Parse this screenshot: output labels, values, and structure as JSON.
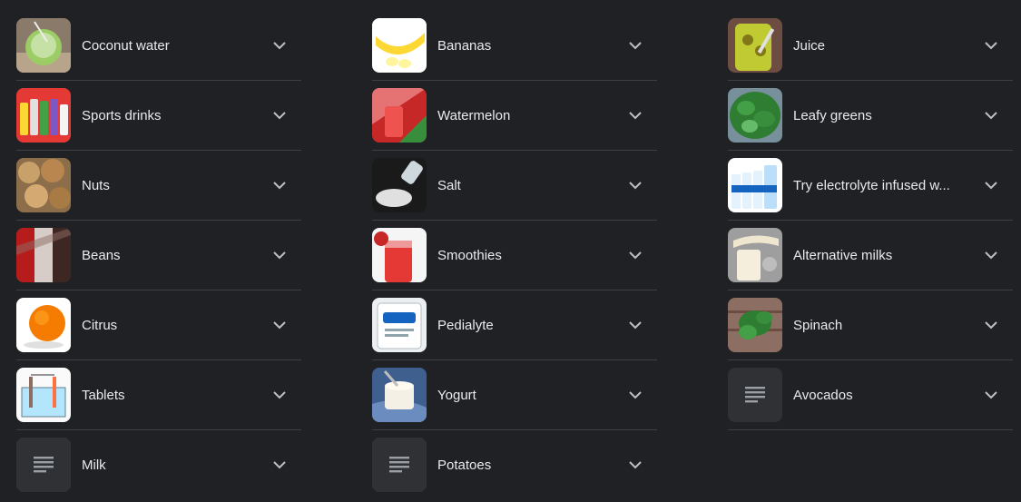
{
  "columns": [
    {
      "items": [
        {
          "label": "Coconut water",
          "thumb": "coconut-water-image"
        },
        {
          "label": "Sports drinks",
          "thumb": "sports-drinks-image"
        },
        {
          "label": "Nuts",
          "thumb": "nuts-image"
        },
        {
          "label": "Beans",
          "thumb": "beans-image"
        },
        {
          "label": "Citrus",
          "thumb": "citrus-image"
        },
        {
          "label": "Tablets",
          "thumb": "tablets-image"
        },
        {
          "label": "Milk",
          "thumb": "article-placeholder-icon"
        }
      ]
    },
    {
      "items": [
        {
          "label": "Bananas",
          "thumb": "bananas-image"
        },
        {
          "label": "Watermelon",
          "thumb": "watermelon-image"
        },
        {
          "label": "Salt",
          "thumb": "salt-image"
        },
        {
          "label": "Smoothies",
          "thumb": "smoothies-image"
        },
        {
          "label": "Pedialyte",
          "thumb": "pedialyte-image"
        },
        {
          "label": "Yogurt",
          "thumb": "yogurt-image"
        },
        {
          "label": "Potatoes",
          "thumb": "article-placeholder-icon"
        }
      ]
    },
    {
      "items": [
        {
          "label": "Juice",
          "thumb": "juice-image"
        },
        {
          "label": "Leafy greens",
          "thumb": "leafy-greens-image"
        },
        {
          "label": "Try electrolyte infused w...",
          "thumb": "electrolyte-water-image"
        },
        {
          "label": "Alternative milks",
          "thumb": "alternative-milks-image"
        },
        {
          "label": "Spinach",
          "thumb": "spinach-image"
        },
        {
          "label": "Avocados",
          "thumb": "article-placeholder-icon"
        }
      ]
    }
  ],
  "chevron_icon": "chevron-down-icon",
  "colors": {
    "background": "#202124",
    "text": "#e8eaed",
    "divider": "#3c4043",
    "icon": "#bdc1c6",
    "placeholder_bg": "#303134"
  }
}
